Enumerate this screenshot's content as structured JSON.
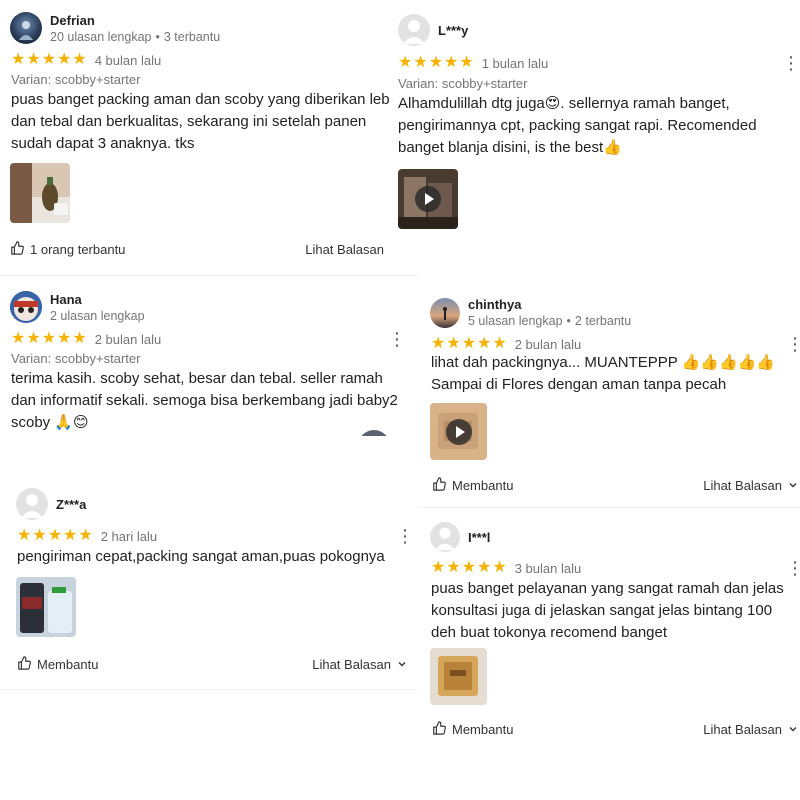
{
  "icons": {
    "star": "★",
    "thumb_up": "thumb-up-icon",
    "chevron": "chevron-down-icon",
    "kebab": "⋮"
  },
  "colors": {
    "star": "#f5b301",
    "meta": "#757575",
    "text": "#222222"
  },
  "reviews": [
    {
      "name": "Defrian",
      "stats": "20 ulasan lengkap",
      "helped_count": "3 terbantu",
      "stars": 5,
      "time": "4 bulan lalu",
      "variant": "Varian: scobby+starter",
      "text": "puas banget packing aman dan scoby yang diberikan lebar dan tebal dan berkualitas, sekarang ini setelah panen sudah dapat 3 anaknya. tks",
      "helpful": "1 orang terbantu",
      "reply": "Lihat Balasan",
      "media": "photo"
    },
    {
      "name": "L***y",
      "stars": 5,
      "time": "1 bulan lalu",
      "variant": "Varian: scobby+starter",
      "text": "Alhamdulillah dtg juga😍. sellernya ramah banget, pengirimannya cpt, packing sangat rapi. Recomended banget blanja disini, is the best👍",
      "media": "video"
    },
    {
      "name": "Hana",
      "stats": "2 ulasan lengkap",
      "stars": 5,
      "time": "2 bulan lalu",
      "variant": "Varian: scobby+starter",
      "text": "terima kasih. scoby sehat, besar dan tebal. seller ramah dan informatif sekali. semoga bisa berkembang jadi baby2 scoby 🙏😊"
    },
    {
      "name": "chinthya",
      "stats": "5 ulasan lengkap",
      "helped_count": "2 terbantu",
      "stars": 5,
      "time": "2 bulan lalu",
      "text": "lihat dah packingnya... MUANTEPPP 👍👍👍👍👍 Sampai di Flores dengan aman tanpa pecah",
      "helpful": "Membantu",
      "reply": "Lihat Balasan",
      "media": "video"
    },
    {
      "name": "Z***a",
      "stars": 5,
      "time": "2 hari lalu",
      "text": "pengiriman cepat,packing sangat aman,puas pokognya",
      "helpful": "Membantu",
      "reply": "Lihat Balasan",
      "media": "photo"
    },
    {
      "name": "I***l",
      "stars": 5,
      "time": "3 bulan lalu",
      "text": "puas banget pelayanan yang sangat ramah dan jelas konsultasi juga di jelaskan sangat jelas bintang 100 deh buat tokonya recomend banget",
      "helpful": "Membantu",
      "reply": "Lihat Balasan",
      "media": "photo"
    }
  ]
}
